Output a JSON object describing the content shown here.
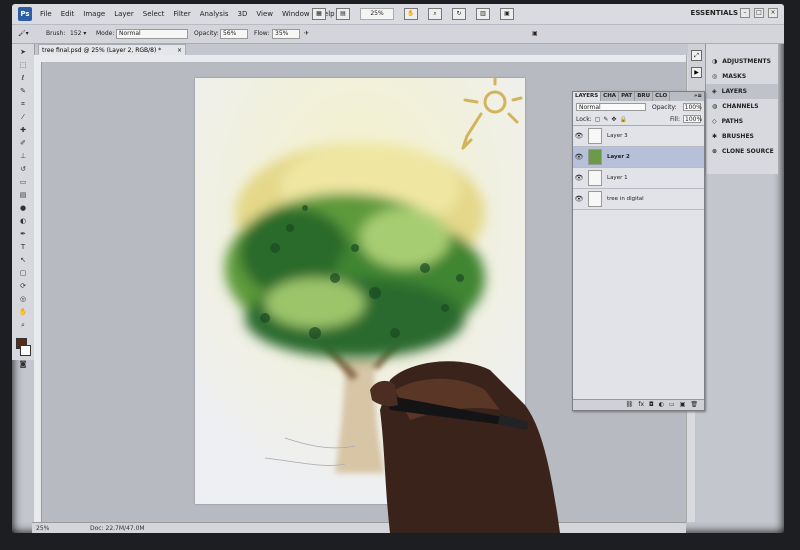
{
  "app": {
    "logo": "Ps",
    "menus": [
      "File",
      "Edit",
      "Image",
      "Layer",
      "Select",
      "Filter",
      "Analysis",
      "3D",
      "View",
      "Window",
      "Help"
    ],
    "zoom_display": "25%",
    "workspace": "ESSENTIALS"
  },
  "options_bar": {
    "brush_label": "Brush:",
    "brush_size": "152",
    "mode_label": "Mode:",
    "mode_value": "Normal",
    "opacity_label": "Opacity:",
    "opacity_value": "56%",
    "flow_label": "Flow:",
    "flow_value": "35%"
  },
  "document": {
    "tab_title": "tree final.psd @ 25% (Layer 2, RGB/8) *",
    "tab_close": "×"
  },
  "status_bar": {
    "zoom": "25%",
    "doc_info": "Doc: 22.7M/47.0M"
  },
  "right_panel": {
    "items": [
      {
        "label": "ADJUSTMENTS",
        "icon": "adjustments-icon"
      },
      {
        "label": "MASKS",
        "icon": "masks-icon"
      },
      {
        "label": "LAYERS",
        "icon": "layers-icon"
      },
      {
        "label": "CHANNELS",
        "icon": "channels-icon"
      },
      {
        "label": "PATHS",
        "icon": "paths-icon"
      },
      {
        "label": "BRUSHES",
        "icon": "brushes-icon"
      },
      {
        "label": "CLONE SOURCE",
        "icon": "clone-source-icon"
      }
    ]
  },
  "layers_panel": {
    "tabs": [
      "LAYERS",
      "CHA",
      "PAT",
      "BRU",
      "CLO"
    ],
    "blend_mode": "Normal",
    "opacity_label": "Opacity:",
    "opacity_value": "100%",
    "lock_label": "Lock:",
    "fill_label": "Fill:",
    "fill_value": "100%",
    "layers": [
      {
        "name": "Layer 3",
        "selected": false
      },
      {
        "name": "Layer 2",
        "selected": true
      },
      {
        "name": "Layer 1",
        "selected": false
      },
      {
        "name": "tree in digital",
        "selected": false
      }
    ]
  },
  "colors": {
    "foreground": "#5a2a1a",
    "background": "#ffffff",
    "selected_layer": "#b6c0d8"
  }
}
